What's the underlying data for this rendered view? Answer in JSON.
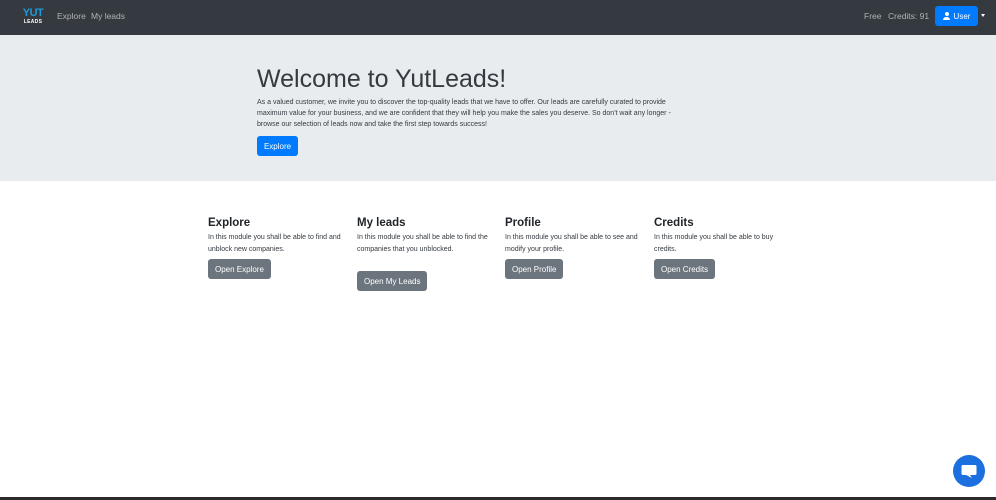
{
  "navbar": {
    "brand_top": "YUT",
    "brand_bottom": "LEADS",
    "links": {
      "explore": "Explore",
      "my_leads": "My leads"
    },
    "plan": "Free",
    "credits": "Credits: 91",
    "user_label": "User"
  },
  "hero": {
    "title": "Welcome to YutLeads!",
    "text": "As a valued customer, we invite you to discover the top-quality leads that we have to offer. Our leads are carefully curated to provide maximum value for your business, and we are confident that they will help you make the sales you deserve. So don't wait any longer - browse our selection of leads now and take the first step towards success!",
    "button_label": "Explore"
  },
  "modules": {
    "explore": {
      "title": "Explore",
      "description": "In this module you shall be able to find and unblock new companies.",
      "button_label": "Open Explore"
    },
    "my_leads": {
      "title": "My leads",
      "description": "In this module you shall be able to find the companies that you unblocked.",
      "button_label": "Open My Leads"
    },
    "profile": {
      "title": "Profile",
      "description": "In this module you shall be able to see and modify your profile.",
      "button_label": "Open Profile"
    },
    "credits": {
      "title": "Credits",
      "description": "In this module you shall be able to buy credits.",
      "button_label": "Open Credits"
    }
  },
  "icons": {
    "user": "user-icon",
    "chat": "chat-bubble-icon",
    "caret": "caret-down-icon"
  },
  "colors": {
    "navbar": "#343a40",
    "primary": "#007bff",
    "secondary": "#6c757d",
    "jumbotron": "#e9ecef",
    "chat": "#1b6fdf"
  }
}
